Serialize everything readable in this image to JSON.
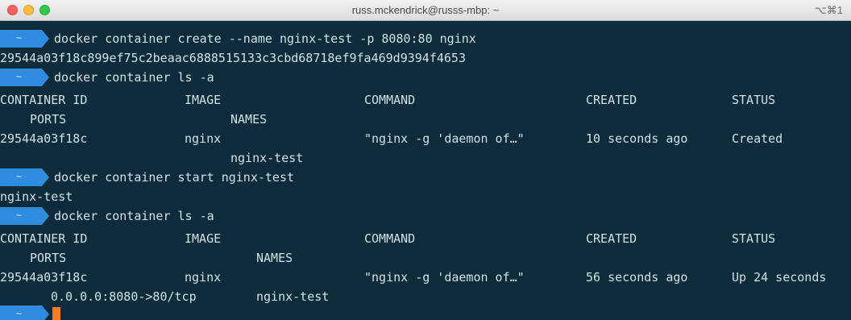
{
  "window": {
    "title": "russ.mckendrick@russs-mbp: ~",
    "shortcut": "⌥⌘1"
  },
  "colors": {
    "terminal_bg": "#0d2b3a",
    "prompt_bg": "#2f8ce0",
    "text": "#cfe3e6",
    "cursor": "#f57c2a"
  },
  "terminal": {
    "prompt_symbol": "~",
    "commands": {
      "create": "docker container create --name nginx-test -p 8080:80 nginx",
      "ls1": "docker container ls -a",
      "start": "docker container start nginx-test",
      "ls2": "docker container ls -a"
    },
    "container_hash": "29544a03f18c899ef75c2beaac6888515133c3cbd68718ef9fa469d9394f4653",
    "start_output": "nginx-test",
    "headers": {
      "container_id": "CONTAINER ID",
      "image": "IMAGE",
      "command": "COMMAND",
      "created": "CREATED",
      "status": "STATUS",
      "ports": "PORTS",
      "names": "NAMES"
    },
    "ls1_row": {
      "container_id": "29544a03f18c",
      "image": "nginx",
      "command": "\"nginx -g 'daemon of…\"",
      "created": "10 seconds ago",
      "status": "Created",
      "names": "nginx-test"
    },
    "ls2_row": {
      "container_id": "29544a03f18c",
      "image": "nginx",
      "command": "\"nginx -g 'daemon of…\"",
      "created": "56 seconds ago",
      "status": "Up 24 seconds",
      "ports": "0.0.0.0:8080->80/tcp",
      "names": "nginx-test"
    }
  }
}
